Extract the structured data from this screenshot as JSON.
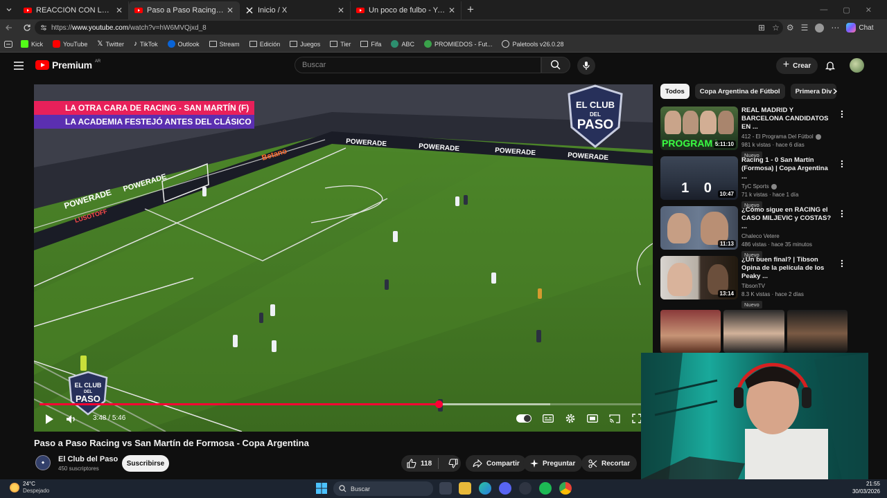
{
  "browser": {
    "tabs": [
      {
        "title": "REACCIÓN CON LOS HINCHAS / R",
        "icon": "youtube-icon",
        "active": false
      },
      {
        "title": "Paso a Paso Racing vs San Martín",
        "icon": "youtube-icon",
        "active": true
      },
      {
        "title": "Inicio / X",
        "icon": "x-icon",
        "active": false
      },
      {
        "title": "Un poco de fulbo - YouTube",
        "icon": "youtube-icon",
        "active": false
      }
    ],
    "url_prefix": "https://",
    "url_host": "www.youtube.com",
    "url_path": "/watch?v=hW6MVQjxd_8",
    "chat_label": "Chat",
    "bookmarks": [
      "Kick",
      "YouTube",
      "Twitter",
      "TikTok",
      "Outlook",
      "Stream",
      "Edición",
      "Juegos",
      "Tier",
      "Fifa",
      "ABC",
      "PROMIEDOS - Fut...",
      "Paletools v26.0.28"
    ]
  },
  "youtube": {
    "logo_text": "Premium",
    "country": "AR",
    "search_placeholder": "Buscar",
    "create_label": "Crear"
  },
  "video": {
    "overlay_line1": "LA OTRA CARA DE RACING - SAN MARTÍN (F)",
    "overlay_line2": "LA ACADEMIA FESTEJÓ ANTES DEL CLÁSICO",
    "logo_line1": "EL CLUB",
    "logo_line2": "DEL",
    "logo_line3": "PASO",
    "ad_boards": [
      "POWERADE",
      "LUSOTOFF",
      "Betano"
    ],
    "current_time": "3:48",
    "duration": "5:46",
    "progress_fraction": 0.657,
    "buffered_fraction": 0.84,
    "title": "Paso a Paso Racing vs San Martín de Formosa - Copa Argentina",
    "channel_name": "El Club del Paso",
    "channel_subs": "450 suscriptores",
    "subscribe_label": "Suscribirse",
    "likes": "118",
    "share_label": "Compartir",
    "ask_label": "Preguntar",
    "clip_label": "Recortar"
  },
  "sidebar": {
    "chips": [
      "Todos",
      "Copa Argentina de Fútbol",
      "Primera Div"
    ],
    "recommendations": [
      {
        "title": "REAL MADRID Y BARCELONA CANDIDATOS EN ...",
        "channel": "412 - El Programa Del Fútbol",
        "verified": true,
        "meta": "981 k vistas · hace 6 días",
        "badge": "Nuevo",
        "duration": "5:11:10",
        "thumb_text": "PROGRAMA"
      },
      {
        "title": "Racing 1 - 0 San Martín (Formosa) | Copa Argentina ...",
        "channel": "TyC Sports",
        "verified": true,
        "meta": "71 k vistas · hace 1 día",
        "badge": "Nuevo",
        "duration": "10:47",
        "thumb_text": "1 0"
      },
      {
        "title": "¿Cómo sigue en RACING el CASO MILJEVIC y COSTAS? ...",
        "channel": "Chaleco Vetere",
        "verified": false,
        "meta": "486 vistas · hace 35 minutos",
        "badge": "Nuevo",
        "duration": "11:13",
        "thumb_text": ""
      },
      {
        "title": "¿Un buen final? | Tibson Opina de la película de los Peaky ...",
        "channel": "TibsonTV",
        "verified": false,
        "meta": "8.3 K vistas · hace 2 días",
        "badge": "Nuevo",
        "duration": "13:14",
        "thumb_text": ""
      }
    ]
  },
  "taskbar": {
    "temperature": "24°C",
    "condition": "Despejado",
    "search_label": "Buscar",
    "time": "21:55",
    "date": "30/03/2026"
  }
}
